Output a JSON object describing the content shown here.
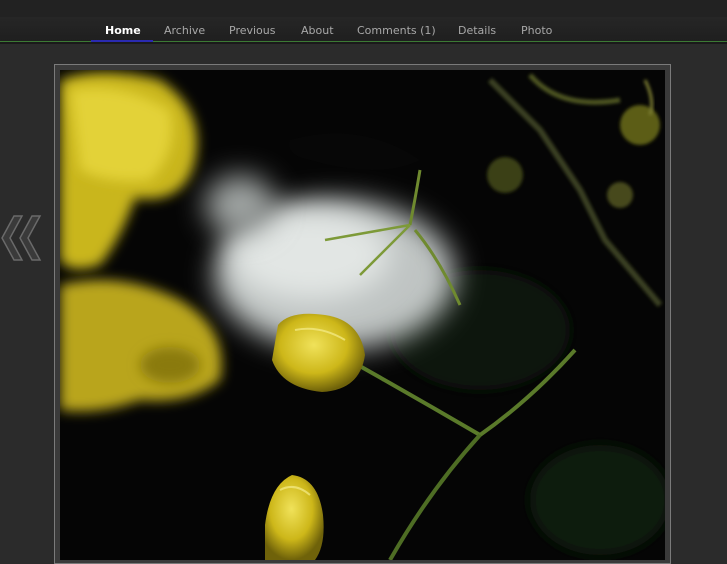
{
  "nav": {
    "items": [
      {
        "label": "Home",
        "active": true
      },
      {
        "label": "Archive",
        "active": false
      },
      {
        "label": "Previous",
        "active": false
      },
      {
        "label": "About",
        "active": false
      },
      {
        "label": "Comments (1)",
        "active": false
      },
      {
        "label": "Details",
        "active": false
      },
      {
        "label": "Photo",
        "active": false
      }
    ]
  },
  "controls": {
    "previous_icon": "double-chevron-left-icon"
  },
  "photo": {
    "subject": "yellow-flower-buds-on-dark-background"
  },
  "colors": {
    "background": "#2b2b2b",
    "nav_accent": "#3c7a34",
    "active_underline": "#2a2ab0",
    "flower_yellow": "#d8c21c"
  }
}
